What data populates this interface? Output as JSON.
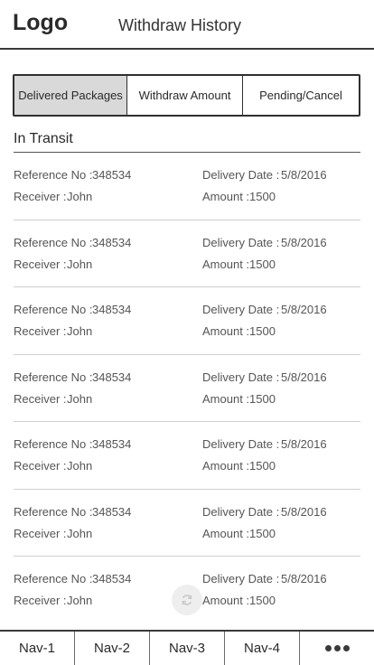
{
  "header": {
    "logo": "Logo",
    "title": "Withdraw History"
  },
  "tabs": [
    {
      "label": "Delivered Packages",
      "active": true
    },
    {
      "label": "Withdraw Amount",
      "active": false
    },
    {
      "label": "Pending/Cancel",
      "active": false
    }
  ],
  "section": {
    "title": "In Transit"
  },
  "labels": {
    "reference": "Reference No :",
    "receiver": "Receiver  :",
    "delivery_date": "Delivery Date  :",
    "amount": "Amount  :"
  },
  "items": [
    {
      "reference": "348534",
      "receiver": "John",
      "delivery_date": "5/8/2016",
      "amount": "1500"
    },
    {
      "reference": "348534",
      "receiver": "John",
      "delivery_date": "5/8/2016",
      "amount": "1500"
    },
    {
      "reference": "348534",
      "receiver": "John",
      "delivery_date": "5/8/2016",
      "amount": "1500"
    },
    {
      "reference": "348534",
      "receiver": "John",
      "delivery_date": "5/8/2016",
      "amount": "1500"
    },
    {
      "reference": "348534",
      "receiver": "John",
      "delivery_date": "5/8/2016",
      "amount": "1500"
    },
    {
      "reference": "348534",
      "receiver": "John",
      "delivery_date": "5/8/2016",
      "amount": "1500"
    },
    {
      "reference": "348534",
      "receiver": "John",
      "delivery_date": "5/8/2016",
      "amount": "1500"
    }
  ],
  "loading_icon": "refresh-icon",
  "nav": {
    "items": [
      "Nav-1",
      "Nav-2",
      "Nav-3",
      "Nav-4"
    ],
    "more_icon": "more-dots-icon"
  }
}
